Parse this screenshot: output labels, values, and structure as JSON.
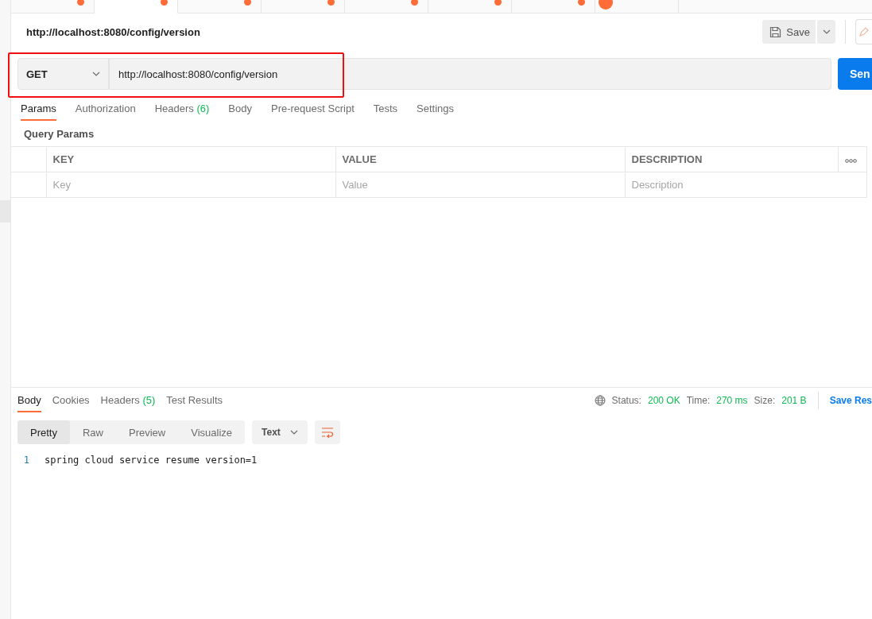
{
  "request_tabs": [
    {
      "kind": "request",
      "selected": false
    },
    {
      "kind": "request",
      "selected": true
    },
    {
      "kind": "request",
      "selected": false
    },
    {
      "kind": "request",
      "selected": false
    },
    {
      "kind": "request",
      "selected": false
    },
    {
      "kind": "request",
      "selected": false
    },
    {
      "kind": "request",
      "selected": false
    },
    {
      "kind": "runner",
      "selected": false
    }
  ],
  "request": {
    "title": "http://localhost:8080/config/version",
    "save": "Save",
    "method": "GET",
    "url": "http://localhost:8080/config/version",
    "send": "Sen"
  },
  "request_tabs_2": [
    {
      "label": "Params",
      "selected": true
    },
    {
      "label": "Authorization",
      "selected": false
    },
    {
      "label": "Headers",
      "count": "(6)",
      "selected": false
    },
    {
      "label": "Body",
      "selected": false
    },
    {
      "label": "Pre-request Script",
      "selected": false
    },
    {
      "label": "Tests",
      "selected": false
    },
    {
      "label": "Settings",
      "selected": false
    }
  ],
  "query_params": {
    "title": "Query Params",
    "columns": [
      "KEY",
      "VALUE",
      "DESCRIPTION"
    ],
    "placeholders": [
      "Key",
      "Value",
      "Description"
    ]
  },
  "response": {
    "tabs": [
      {
        "label": "Body",
        "selected": true
      },
      {
        "label": "Cookies",
        "selected": false
      },
      {
        "label": "Headers",
        "count": "(5)",
        "selected": false
      },
      {
        "label": "Test Results",
        "selected": false
      }
    ],
    "status_label": "Status:",
    "status": "200 OK",
    "time_label": "Time:",
    "time": "270 ms",
    "size_label": "Size:",
    "size": "201 B",
    "save_response": "Save Res",
    "views": [
      {
        "label": "Pretty",
        "selected": true
      },
      {
        "label": "Raw",
        "selected": false
      },
      {
        "label": "Preview",
        "selected": false
      },
      {
        "label": "Visualize",
        "selected": false
      }
    ],
    "format": "Text",
    "lines": [
      {
        "number": "1",
        "text": "spring cloud service resume version=1"
      }
    ]
  }
}
